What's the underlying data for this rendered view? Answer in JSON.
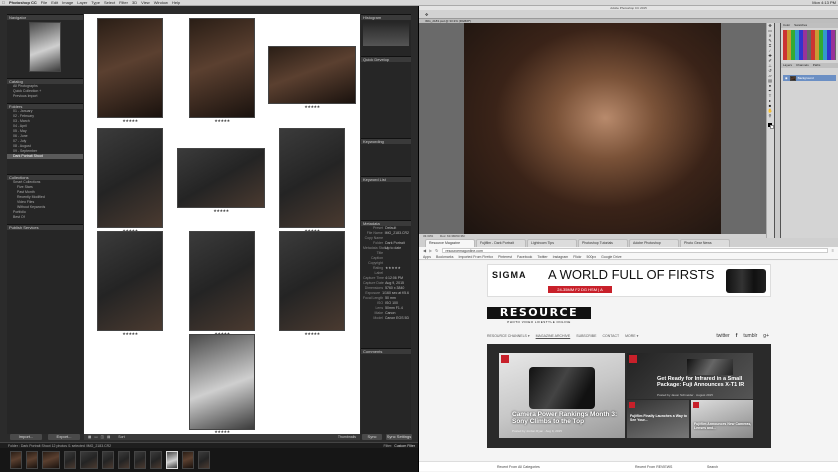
{
  "menubar": {
    "app": "Photoshop CC",
    "items": [
      "File",
      "Edit",
      "Image",
      "Layer",
      "Type",
      "Select",
      "Filter",
      "3D",
      "View",
      "Window",
      "Help"
    ],
    "status": "Mon 4:13 PM"
  },
  "lightroom": {
    "panels": {
      "navigator": "Navigator",
      "catalog": "Catalog",
      "folders": "Folders",
      "collections": "Collections",
      "publish": "Publish Services",
      "histogram": "Histogram",
      "quick_develop": "Quick Develop",
      "keywording": "Keywording",
      "keyword_list": "Keyword List",
      "metadata": "Metadata",
      "comments": "Comments"
    },
    "catalog_items": [
      {
        "label": "All Photographs",
        "count": ""
      },
      {
        "label": "Quick Collection +",
        "count": ""
      },
      {
        "label": "Previous Import",
        "count": ""
      }
    ],
    "folders": [
      {
        "label": "01 - January",
        "count": ""
      },
      {
        "label": "02 - February",
        "count": ""
      },
      {
        "label": "03 - March",
        "count": ""
      },
      {
        "label": "04 - April",
        "count": ""
      },
      {
        "label": "05 - May",
        "count": ""
      },
      {
        "label": "06 - June",
        "count": ""
      },
      {
        "label": "07 - July",
        "count": ""
      },
      {
        "label": "08 - August",
        "count": ""
      },
      {
        "label": "09 - September",
        "count": ""
      },
      {
        "label": "Dark Portrait Shoot",
        "count": ""
      }
    ],
    "collections": [
      {
        "label": "Smart Collections"
      },
      {
        "label": "Five Stars"
      },
      {
        "label": "Past Month"
      },
      {
        "label": "Recently Modified"
      },
      {
        "label": "Video Files"
      },
      {
        "label": "Without Keywords"
      },
      {
        "label": "Portfolio"
      },
      {
        "label": "Best Of"
      }
    ],
    "metadata_rows": [
      {
        "k": "Preset",
        "v": "Default"
      },
      {
        "k": "File Name",
        "v": "IMG_2183.CR2"
      },
      {
        "k": "Copy Name",
        "v": ""
      },
      {
        "k": "Folder",
        "v": "Dark Portrait"
      },
      {
        "k": "Metadata Status",
        "v": "Up to date"
      },
      {
        "k": "Title",
        "v": ""
      },
      {
        "k": "Caption",
        "v": ""
      },
      {
        "k": "Copyright",
        "v": ""
      },
      {
        "k": "Rating",
        "v": "★★★★★"
      },
      {
        "k": "Label",
        "v": ""
      },
      {
        "k": "Capture Time",
        "v": "4:12:06 PM"
      },
      {
        "k": "Capture Date",
        "v": "Aug 9, 2015"
      },
      {
        "k": "Dimensions",
        "v": "5760 x 3840"
      },
      {
        "k": "Exposure",
        "v": "1/160 sec at f/5.6"
      },
      {
        "k": "Focal Length",
        "v": "50 mm"
      },
      {
        "k": "ISO",
        "v": "ISO 100"
      },
      {
        "k": "Lens",
        "v": "50mm F1.4"
      },
      {
        "k": "Make",
        "v": "Canon"
      },
      {
        "k": "Model",
        "v": "Canon EOS 5D"
      }
    ],
    "bottom_buttons": {
      "import": "Import...",
      "export": "Export...",
      "sync": "Sync",
      "sync_settings": "Sync Settings"
    },
    "toolbar": {
      "sort_label": "Sort",
      "thumbnails_label": "Thumbnails"
    },
    "filmstrip_info": "Folder : Dark Portrait Shoot   12 photos /1 selected /IMG_2183.CR2",
    "filter_label": "Filter:",
    "filter_value": "Custom Filter",
    "photo_stars": "★★★★★"
  },
  "photoshop": {
    "title": "Adobe Photoshop CC 2015",
    "doc_tab": "IMG_2183.psd @ 33.3% (RGB/8*)",
    "zoom": "33.33%",
    "panels": {
      "color": "Color",
      "swatches": "Swatches",
      "layers": "Layers",
      "channels": "Channels",
      "paths": "Paths"
    },
    "layer_name": "Background",
    "status": "Doc: 63.3M/63.3M"
  },
  "chrome": {
    "tabs": [
      "Resource Magazine",
      "Fujifilm - Dark Portrait",
      "Lightroom Tips",
      "Photoshop Tutorials",
      "Adobe Photoshop",
      "Photo Gear News"
    ],
    "url": "resourcemagonline.com",
    "bookmarks": [
      "Apps",
      "Bookmarks",
      "Imported From Firefox",
      "Pinterest",
      "Facebook",
      "Twitter",
      "Instagram",
      "Flickr",
      "500px",
      "Google Drive"
    ],
    "ad": {
      "brand": "SIGMA",
      "headline": "A WORLD FULL OF FIRSTS",
      "sub": "24-35MM F2 DG HSM | A"
    },
    "site": {
      "logo": "RESOURCE",
      "tagline": "PHOTO VIDEO LIFESTYLE ONLINE",
      "nav": [
        "RESOURCE CHANNELS ▾",
        "MAGAZINE ARCHIVE",
        "SUBSCRIBE",
        "CONTACT",
        "MORE ▾"
      ],
      "social": [
        "twitter",
        "f",
        "tumblr",
        "g+"
      ],
      "feature_title": "Camera Power Rankings Month 3: Sony Climbs to the Top",
      "feature_meta": "Posted by Jordan Ryan · Aug 9, 2015",
      "side_title": "Get Ready for Infrared in a Small Package: Fuji Announces X-T1 IR",
      "side_meta": "Posted by Jason Schneider · August 2015",
      "mini1": "Fujifilm Finally Launches a Way to See Your...",
      "mini2": "Fujifilm Announces New Cameras, Lenses and...",
      "recent_label": "Recent From",
      "recent_from": "Recent From All Categories",
      "recent_reviews": "Recent From REVIEWS",
      "search": "Search"
    }
  }
}
